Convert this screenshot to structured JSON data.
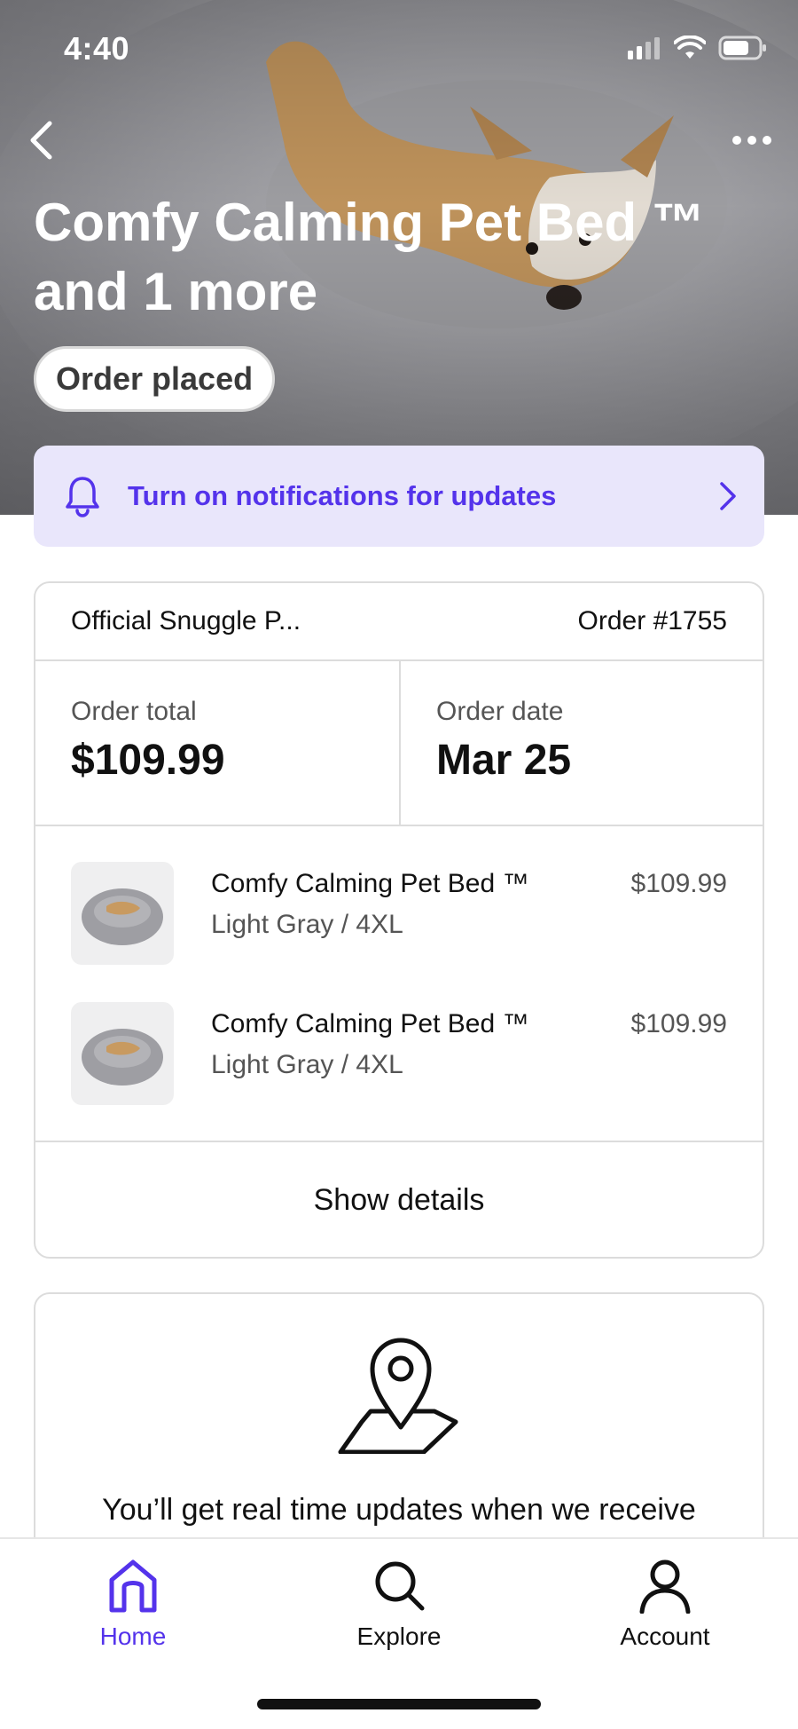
{
  "status_bar": {
    "time": "4:40"
  },
  "hero": {
    "title": "Comfy Calming Pet Bed ™ and 1 more",
    "status": "Order placed"
  },
  "notification": {
    "text": "Turn on notifications for updates",
    "icon": "bell-icon"
  },
  "order": {
    "shop": "Official Snuggle P...",
    "number": "Order #1755",
    "total_label": "Order total",
    "total_value": "$109.99",
    "date_label": "Order date",
    "date_value": "Mar 25",
    "items": [
      {
        "name": "Comfy Calming Pet Bed ™",
        "variant": "Light Gray / 4XL",
        "price": "$109.99"
      },
      {
        "name": "Comfy Calming Pet Bed ™",
        "variant": "Light Gray / 4XL",
        "price": "$109.99"
      }
    ],
    "show_details": "Show details"
  },
  "updates": {
    "icon": "map-pin-icon",
    "text": "You’ll get real time updates when we receive"
  },
  "tabs": [
    {
      "label": "Home",
      "icon": "home-icon",
      "active": true
    },
    {
      "label": "Explore",
      "icon": "search-icon",
      "active": false
    },
    {
      "label": "Account",
      "icon": "account-icon",
      "active": false
    }
  ],
  "colors": {
    "accent": "#5433eb",
    "banner_bg": "#e9e6fb",
    "border": "#dcdcdc"
  }
}
